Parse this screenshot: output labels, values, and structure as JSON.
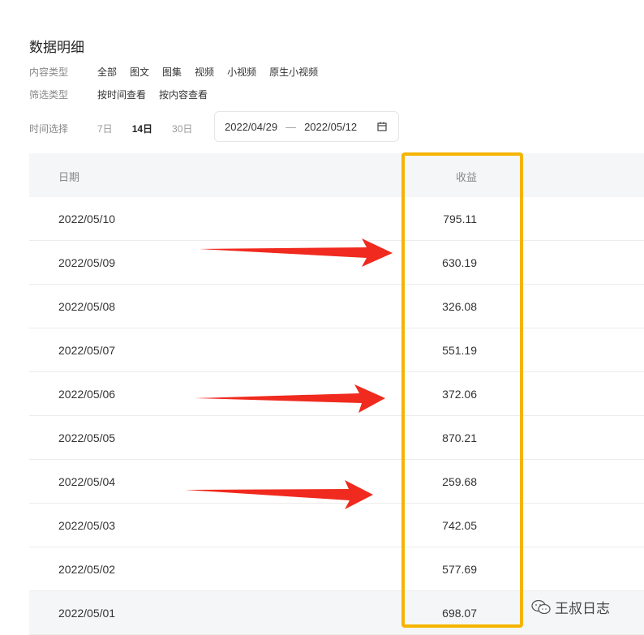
{
  "page": {
    "title": "数据明细"
  },
  "filters": {
    "content_type": {
      "label": "内容类型",
      "options": [
        "全部",
        "图文",
        "图集",
        "视频",
        "小视频",
        "原生小视频"
      ]
    },
    "filter_type": {
      "label": "筛选类型",
      "options": [
        "按时间查看",
        "按内容查看"
      ]
    },
    "time_select": {
      "label": "时间选择",
      "options": [
        "7日",
        "14日",
        "30日"
      ],
      "selected": "14日"
    },
    "date_range": {
      "start": "2022/04/29",
      "separator": "—",
      "end": "2022/05/12",
      "icon": "calendar-icon"
    }
  },
  "table": {
    "headers": {
      "date": "日期",
      "income": "收益"
    },
    "rows": [
      {
        "date": "2022/05/10",
        "income": "795.11"
      },
      {
        "date": "2022/05/09",
        "income": "630.19"
      },
      {
        "date": "2022/05/08",
        "income": "326.08"
      },
      {
        "date": "2022/05/07",
        "income": "551.19"
      },
      {
        "date": "2022/05/06",
        "income": "372.06"
      },
      {
        "date": "2022/05/05",
        "income": "870.21"
      },
      {
        "date": "2022/05/04",
        "income": "259.68"
      },
      {
        "date": "2022/05/03",
        "income": "742.05"
      },
      {
        "date": "2022/05/02",
        "income": "577.69"
      },
      {
        "date": "2022/05/01",
        "income": "698.07"
      }
    ]
  },
  "annotations": {
    "highlight_color": "#f5b400",
    "arrow_color": "#f02a1e"
  },
  "watermark": {
    "text": "王叔日志",
    "icon": "wechat-icon"
  }
}
